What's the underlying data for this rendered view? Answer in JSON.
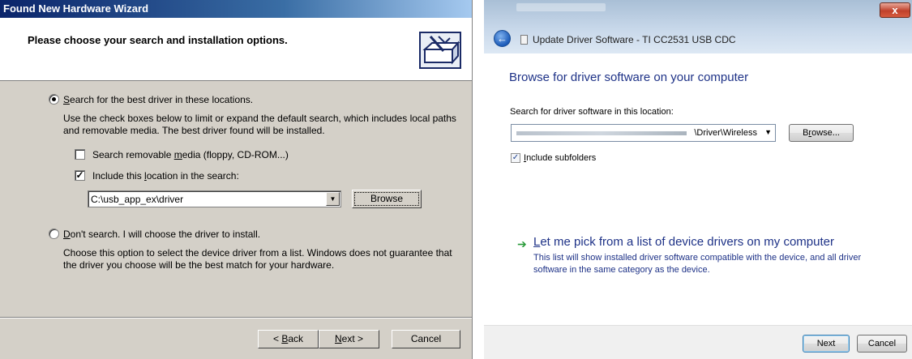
{
  "xp_wizard": {
    "title": "Found New Hardware Wizard",
    "header_title": "Please choose your search and installation options.",
    "header_icon": "hardware-wizard-icon",
    "option_search": {
      "label_pre": "",
      "label_key": "S",
      "label_post": "earch for the best driver in these locations.",
      "selected": true,
      "description": "Use the check boxes below to limit or expand the default search, which includes local paths and removable media. The best driver found will be installed."
    },
    "removable_media": {
      "label_pre": "Search removable ",
      "label_key": "m",
      "label_post": "edia (floppy, CD-ROM...)",
      "checked": false
    },
    "include_location": {
      "label_pre": "Include this ",
      "label_key": "l",
      "label_post": "ocation in the search:",
      "checked": true,
      "check_glyph": "✓"
    },
    "location_value": "C:\\usb_app_ex\\driver",
    "dropdown_glyph": "▼",
    "browse_label": "Browse",
    "option_dont_search": {
      "label_pre": "",
      "label_key": "D",
      "label_post": "on't search. I will choose the driver to install.",
      "selected": false,
      "description": "Choose this option to select the device driver from a list.  Windows does not guarantee that the driver you choose will be the best match for your hardware."
    },
    "buttons": {
      "back": {
        "pre": "< ",
        "key": "B",
        "post": "ack"
      },
      "next": {
        "pre": "",
        "key": "N",
        "post": "ext >"
      },
      "cancel": "Cancel"
    }
  },
  "win7_dialog": {
    "close_glyph": "x",
    "back_glyph": "←",
    "title": "Update Driver Software - TI CC2531 USB CDC",
    "heading": "Browse for driver software on your computer",
    "search_label": "Search for driver software in this location:",
    "path_value": "\\Driver\\Wireless",
    "dropdown_glyph": "▼",
    "browse_label_pre": "B",
    "browse_label_key": "r",
    "browse_label_post": "owse...",
    "include_subfolders": {
      "label_key": "I",
      "label_post": "nclude subfolders",
      "checked": true,
      "check_glyph": "✓"
    },
    "pick_link_arrow": "➔",
    "pick_link": {
      "key": "L",
      "post": "et me pick from a list of device drivers on my computer",
      "description": "This list will show installed driver software compatible with the device, and all driver software in the same category as the device."
    },
    "buttons": {
      "next": "Next",
      "cancel": "Cancel"
    },
    "colors": {
      "heading": "#1e3287",
      "link_arrow": "#2a9b3a"
    }
  }
}
